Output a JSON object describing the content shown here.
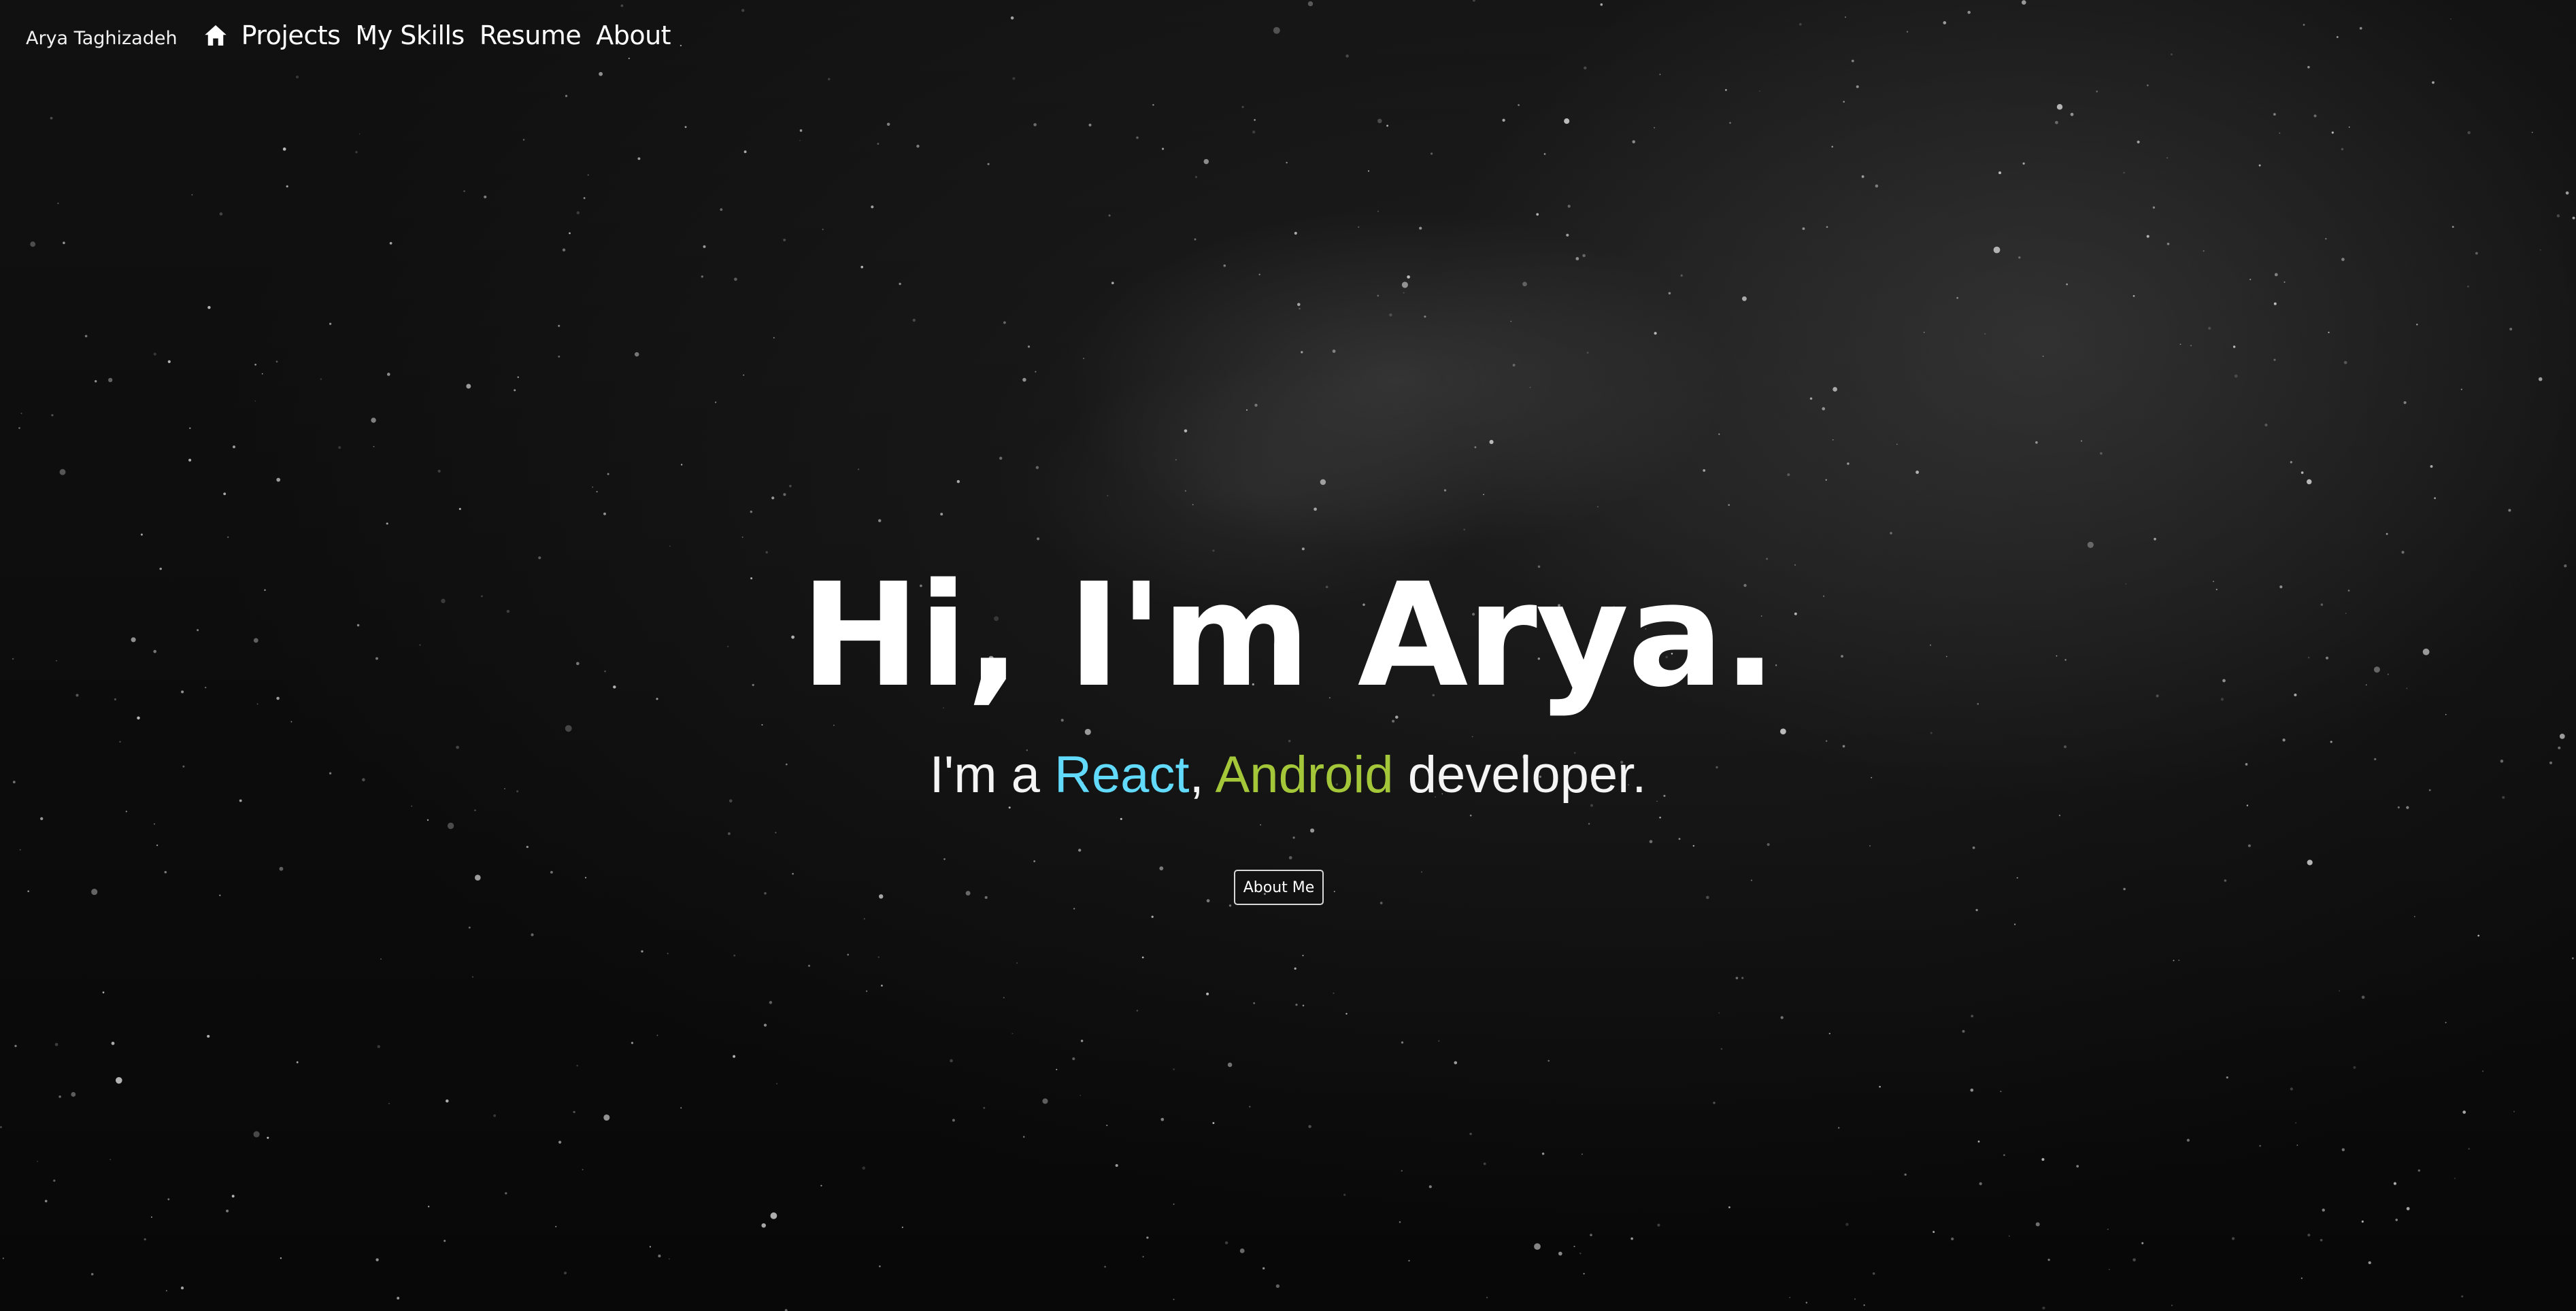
{
  "navbar": {
    "brand": "Arya Taghizadeh",
    "home_icon": "home-icon",
    "links": [
      "Projects",
      "My Skills",
      "Resume",
      "About"
    ]
  },
  "hero": {
    "title": "Hi, I'm Arya.",
    "subtitle": {
      "prefix": "I'm a ",
      "react": "React",
      "comma": ",",
      "android": "Android",
      "suffix": " developer."
    },
    "button_label": "About Me"
  },
  "colors": {
    "background": "#0b0b0b",
    "text": "#ffffff",
    "react_accent": "#61dafb",
    "android_accent": "#a4c639"
  }
}
